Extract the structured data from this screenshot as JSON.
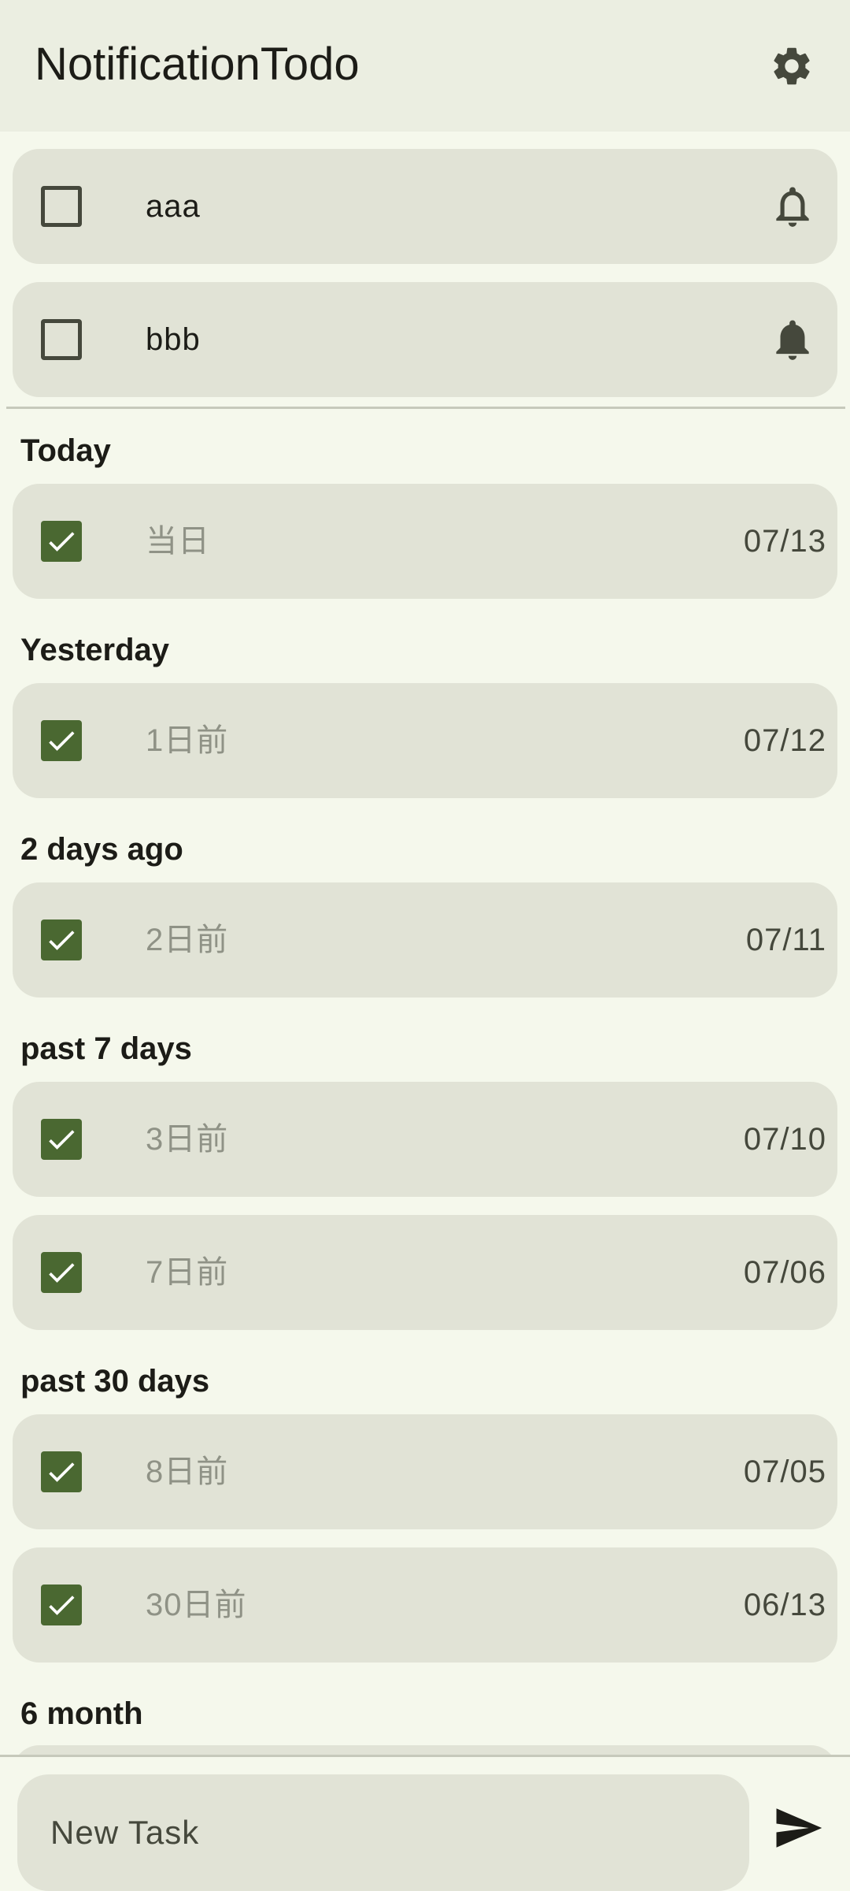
{
  "app": {
    "title": "NotificationTodo",
    "settings_icon": "gear-icon"
  },
  "active_tasks": [
    {
      "text": "aaa",
      "checked": false,
      "notification": "bell-outline-icon"
    },
    {
      "text": "bbb",
      "checked": false,
      "notification": "bell-filled-icon"
    }
  ],
  "sections": [
    {
      "label": "Today",
      "tasks": [
        {
          "text": "当日",
          "date": "07/13",
          "checked": true
        }
      ]
    },
    {
      "label": "Yesterday",
      "tasks": [
        {
          "text": "1日前",
          "date": "07/12",
          "checked": true
        }
      ]
    },
    {
      "label": "2 days ago",
      "tasks": [
        {
          "text": "2日前",
          "date": "07/11",
          "checked": true
        }
      ]
    },
    {
      "label": "past 7 days",
      "tasks": [
        {
          "text": "3日前",
          "date": "07/10",
          "checked": true
        },
        {
          "text": "7日前",
          "date": "07/06",
          "checked": true
        }
      ]
    },
    {
      "label": "past 30 days",
      "tasks": [
        {
          "text": "8日前",
          "date": "07/05",
          "checked": true
        },
        {
          "text": "30日前",
          "date": "06/13",
          "checked": true
        }
      ]
    },
    {
      "label": "6 month",
      "tasks": []
    }
  ],
  "input": {
    "placeholder": "New Task",
    "value": ""
  },
  "send_icon": "send-icon",
  "colors": {
    "background": "#f5f8ec",
    "appbar": "#ebeee1",
    "card": "#e1e3d6",
    "checkbox_checked": "#4a6831",
    "text_done": "#8f9286"
  }
}
